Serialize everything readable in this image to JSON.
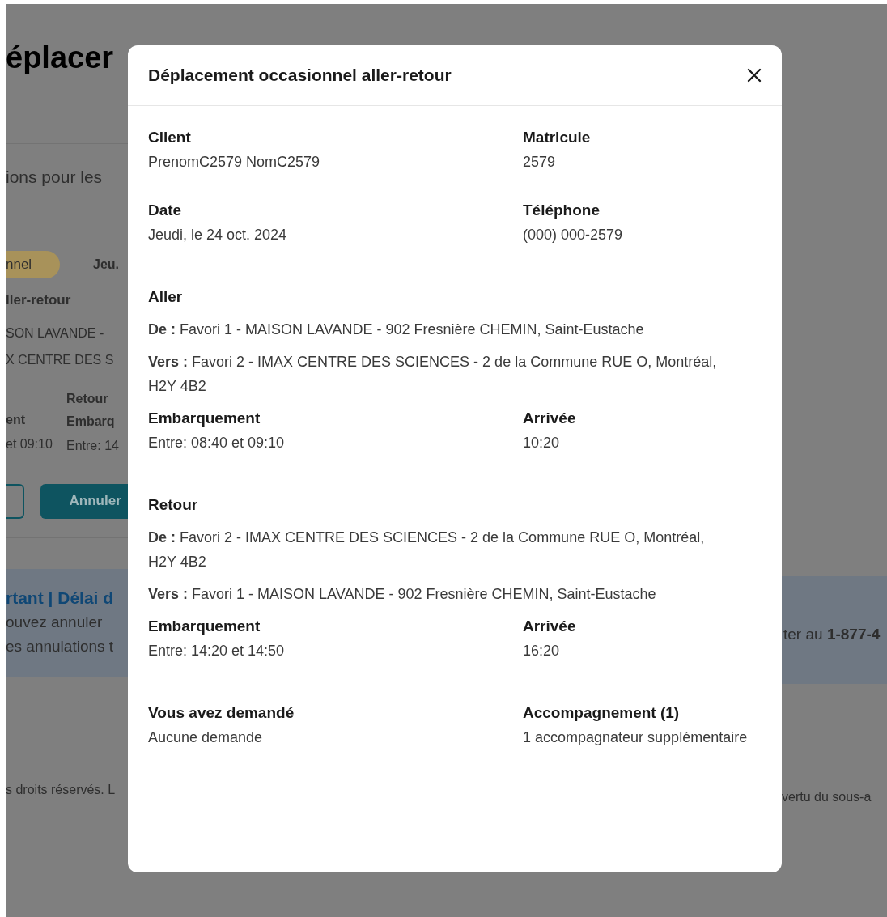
{
  "background": {
    "title": "éplacer",
    "subtitle": "ions pour les",
    "card": {
      "badge": "nnel",
      "date": "Jeu.",
      "trip_type": "ller-retour",
      "from": "SON LAVANDE - ",
      "to": "X CENTRE DES S",
      "left_column": {
        "label": "ent",
        "value": "et 09:10"
      },
      "right_column": {
        "heading": "Retour",
        "label": "Embarq",
        "value": "Entre: 14"
      },
      "buttons": [
        {
          "kind": "outline"
        },
        {
          "kind": "filled",
          "label": "Annuler"
        }
      ]
    },
    "notice": {
      "title": "rtant | Délai d",
      "lines": [
        "ouvez annuler",
        "es annulations t"
      ],
      "right_text": "ter au **1-877-4**"
    },
    "footer": {
      "left": "s droits réservés. L",
      "right": "vertu du sous-a"
    }
  },
  "modal": {
    "title": "Déplacement occasionnel aller-retour",
    "sections": [
      {
        "fields": [
          {
            "label": "Client",
            "value": "PrenomC2579 NomC2579"
          },
          {
            "label": "Matricule",
            "value": "2579"
          },
          {
            "label": "Date",
            "value": "Jeudi, le 24 oct. 2024"
          },
          {
            "label": "Téléphone",
            "value": "(000) 000-2579"
          }
        ]
      },
      {
        "heading": "Aller",
        "lines": [
          "**De :** Favori 1 - MAISON LAVANDE - 902 Fresnière CHEMIN, Saint-Eustache",
          "**Vers :** Favori 2 - IMAX CENTRE DES SCIENCES - 2 de la Commune RUE O, Montréal, H2Y 4B2"
        ],
        "fields": [
          {
            "label": "Embarquement",
            "value": "Entre: 08:40 et 09:10"
          },
          {
            "label": "Arrivée",
            "value": "10:20"
          }
        ]
      },
      {
        "heading": "Retour",
        "lines": [
          "**De :** Favori 2 - IMAX CENTRE DES SCIENCES - 2 de la Commune RUE O, Montréal, H2Y 4B2",
          "**Vers :** Favori 1 - MAISON LAVANDE - 902 Fresnière CHEMIN, Saint-Eustache"
        ],
        "fields": [
          {
            "label": "Embarquement",
            "value": "Entre: 14:20 et 14:50"
          },
          {
            "label": "Arrivée",
            "value": "16:20"
          }
        ]
      },
      {
        "fields": [
          {
            "label": "Vous avez demandé",
            "value": "Aucune demande"
          },
          {
            "label": "Accompagnement (1)",
            "value": "1 accompagnateur supplémentaire"
          }
        ]
      }
    ]
  }
}
